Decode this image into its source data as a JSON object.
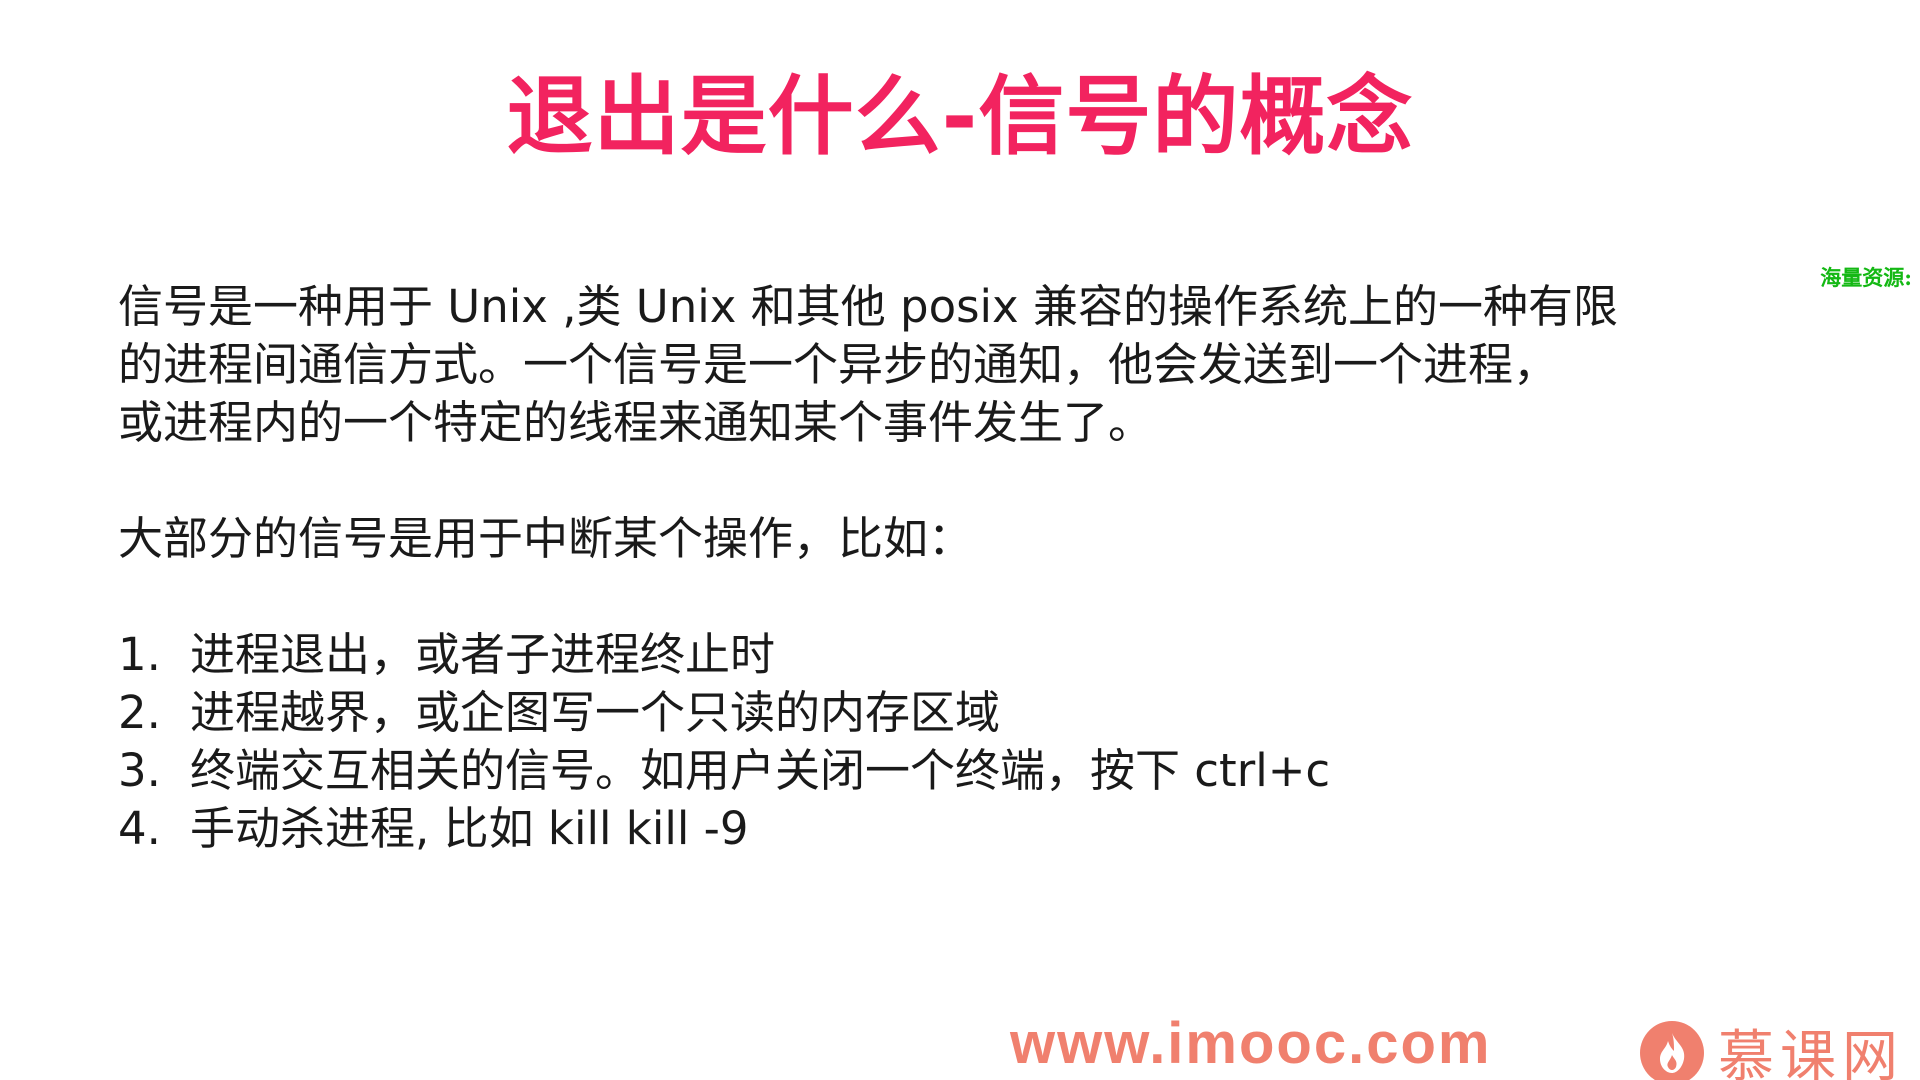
{
  "slide": {
    "title": "退出是什么-信号的概念",
    "side_watermark": "海量资源:",
    "paragraph1_lines": [
      "信号是一种用于 Unix ,类 Unix 和其他 posix 兼容的操作系统上的一种有限",
      "的进程间通信方式。一个信号是一个异步的通知，他会发送到一个进程，",
      "或进程内的一个特定的线程来通知某个事件发生了。"
    ],
    "paragraph2": "大部分的信号是用于中断某个操作，比如：",
    "list": [
      {
        "num": "1.",
        "text": "进程退出，或者子进程终止时"
      },
      {
        "num": "2.",
        "text": "进程越界，或企图写一个只读的内存区域"
      },
      {
        "num": "3.",
        "text": "终端交互相关的信号。如用户关闭一个终端，按下 ctrl+c"
      },
      {
        "num": "4.",
        "text": "手动杀进程, 比如 kill kill -9"
      }
    ]
  },
  "footer": {
    "url": "www.imooc.com",
    "brand_name": "慕课网",
    "brand_icon": "flame-icon"
  },
  "colors": {
    "title": "#f2235f",
    "watermark": "#14b814",
    "footer": "#f0806e",
    "body_text": "#1a1a1a"
  }
}
